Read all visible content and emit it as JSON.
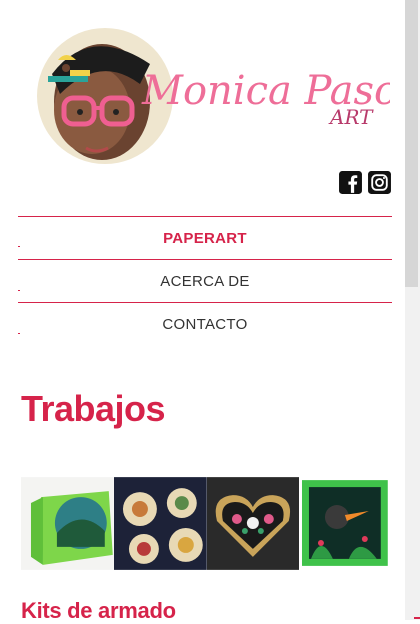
{
  "brand": {
    "name_line": "Monica Pasco",
    "suffix": "ART"
  },
  "social": {
    "icons": [
      "facebook-icon",
      "instagram-icon"
    ]
  },
  "nav": {
    "items": [
      {
        "label": "PAPERART",
        "active": true
      },
      {
        "label": "ACERCA DE",
        "active": false
      },
      {
        "label": "CONTACTO",
        "active": false
      }
    ]
  },
  "sections": {
    "works_title": "Trabajos",
    "kits_title": "Kits de armado"
  },
  "gallery": {
    "items": [
      "paper-cut-landscape",
      "bird-ornaments",
      "floral-heart-plaque",
      "toucan-jungle-frame"
    ]
  },
  "colors": {
    "accent": "#d6234a",
    "text": "#333333"
  }
}
